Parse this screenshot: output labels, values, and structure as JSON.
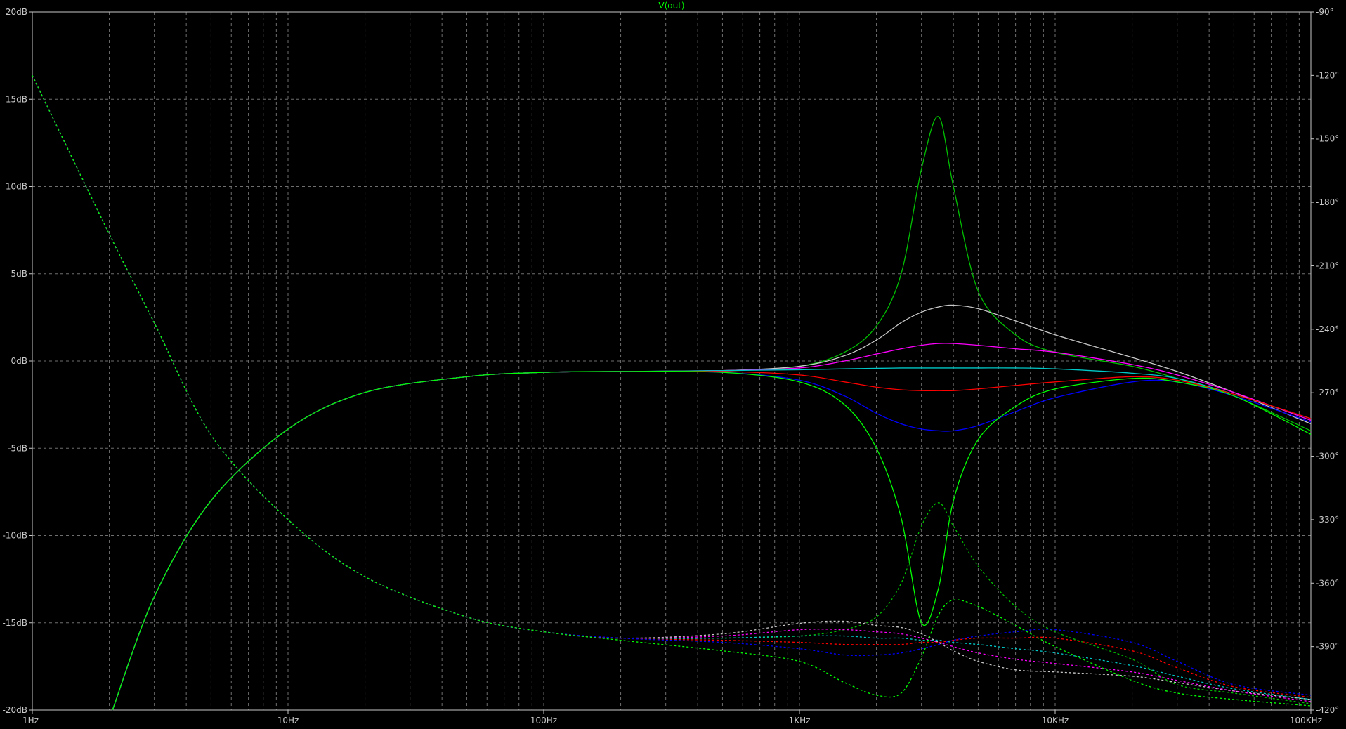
{
  "chart_data": {
    "type": "line",
    "title": "V(out)",
    "x_scale": "log",
    "xlim": [
      1,
      100000
    ],
    "ylim": [
      -20,
      20
    ],
    "y2lim": [
      -420,
      -90
    ],
    "grid": true,
    "x_tick_labels": [
      "1Hz",
      "10Hz",
      "100Hz",
      "1KHz",
      "10KHz",
      "100KHz"
    ],
    "y_tick_labels": [
      "20dB",
      "15dB",
      "10dB",
      "5dB",
      "0dB",
      "-5dB",
      "-10dB",
      "-15dB",
      "-20dB"
    ],
    "y2_tick_labels": [
      "-90°",
      "-120°",
      "-150°",
      "-180°",
      "-210°",
      "-240°",
      "-270°",
      "-300°",
      "-330°",
      "-360°",
      "-390°",
      "-420°"
    ],
    "x_values": [
      1,
      2,
      3,
      5,
      10,
      20,
      50,
      100,
      200,
      500,
      1000,
      1500,
      2000,
      2500,
      3000,
      3500,
      4000,
      5000,
      7000,
      10000,
      20000,
      30000,
      50000,
      100000
    ],
    "series": [
      {
        "color": "#00c000",
        "style": "solid",
        "values": [
          -38.0,
          -20.5,
          -13.5,
          -8.0,
          -3.9,
          -1.8,
          -0.9,
          -0.65,
          -0.6,
          -0.55,
          -0.3,
          0.5,
          2.0,
          5.0,
          11.0,
          14.0,
          10.0,
          4.0,
          1.5,
          0.5,
          -0.3,
          -1.0,
          -2.0,
          -4.0
        ]
      },
      {
        "color": "#c8c8c8",
        "style": "solid",
        "values": [
          -38.0,
          -20.5,
          -13.5,
          -8.0,
          -3.9,
          -1.8,
          -0.9,
          -0.65,
          -0.6,
          -0.55,
          -0.3,
          0.3,
          1.2,
          2.2,
          2.8,
          3.1,
          3.2,
          3.0,
          2.3,
          1.5,
          0.2,
          -0.6,
          -1.8,
          -3.6
        ]
      },
      {
        "color": "#ff00ff",
        "style": "solid",
        "values": [
          -38.0,
          -20.5,
          -13.5,
          -8.0,
          -3.9,
          -1.8,
          -0.9,
          -0.65,
          -0.6,
          -0.55,
          -0.4,
          0.0,
          0.4,
          0.7,
          0.9,
          1.0,
          1.0,
          0.9,
          0.7,
          0.5,
          -0.2,
          -0.8,
          -1.8,
          -3.4
        ]
      },
      {
        "color": "#00c8c8",
        "style": "solid",
        "values": [
          -38.0,
          -20.5,
          -13.5,
          -8.0,
          -3.9,
          -1.8,
          -0.9,
          -0.65,
          -0.6,
          -0.55,
          -0.5,
          -0.45,
          -0.42,
          -0.4,
          -0.4,
          -0.4,
          -0.4,
          -0.4,
          -0.4,
          -0.45,
          -0.7,
          -1.0,
          -1.9,
          -3.3
        ]
      },
      {
        "color": "#ff0000",
        "style": "solid",
        "values": [
          -38.0,
          -20.5,
          -13.5,
          -8.0,
          -3.9,
          -1.8,
          -0.9,
          -0.65,
          -0.6,
          -0.6,
          -0.8,
          -1.2,
          -1.5,
          -1.65,
          -1.7,
          -1.7,
          -1.7,
          -1.6,
          -1.4,
          -1.2,
          -0.9,
          -1.1,
          -1.9,
          -3.3
        ]
      },
      {
        "color": "#0000ff",
        "style": "solid",
        "values": [
          -38.0,
          -20.5,
          -13.5,
          -8.0,
          -3.9,
          -1.8,
          -0.9,
          -0.65,
          -0.6,
          -0.65,
          -1.1,
          -2.0,
          -3.0,
          -3.6,
          -3.9,
          -4.0,
          -4.0,
          -3.7,
          -2.9,
          -2.1,
          -1.2,
          -1.2,
          -2.0,
          -3.5
        ]
      },
      {
        "color": "#00ff00",
        "style": "solid",
        "values": [
          -38.0,
          -20.5,
          -13.5,
          -8.0,
          -3.9,
          -1.8,
          -0.9,
          -0.65,
          -0.6,
          -0.65,
          -1.2,
          -2.5,
          -5.0,
          -9.0,
          -15.0,
          -13.0,
          -8.0,
          -4.5,
          -2.6,
          -1.6,
          -1.0,
          -1.2,
          -2.0,
          -4.2
        ]
      },
      {
        "color": "#00c000",
        "style": "dashed",
        "axis": "phase",
        "values": [
          -120,
          -195,
          -237,
          -290,
          -330,
          -357,
          -376,
          -383,
          -386,
          -386,
          -385,
          -382,
          -376,
          -360,
          -333,
          -322,
          -333,
          -352,
          -371,
          -383,
          -396,
          -408,
          -412,
          -417
        ]
      },
      {
        "color": "#c8c8c8",
        "style": "dashed",
        "axis": "phase",
        "values": [
          -120,
          -195,
          -237,
          -290,
          -330,
          -357,
          -376,
          -383,
          -386,
          -384,
          -379,
          -378,
          -380,
          -381,
          -384,
          -388,
          -392,
          -397,
          -401,
          -402,
          -404,
          -407,
          -411,
          -415
        ]
      },
      {
        "color": "#ff00ff",
        "style": "dashed",
        "axis": "phase",
        "values": [
          -120,
          -195,
          -237,
          -290,
          -330,
          -357,
          -376,
          -383,
          -386,
          -385,
          -382,
          -382,
          -383,
          -384,
          -386,
          -388,
          -390,
          -393,
          -396,
          -398,
          -402,
          -406,
          -411,
          -416
        ]
      },
      {
        "color": "#00c8c8",
        "style": "dashed",
        "axis": "phase",
        "values": [
          -120,
          -195,
          -237,
          -290,
          -330,
          -357,
          -376,
          -383,
          -386,
          -386,
          -385,
          -385,
          -386,
          -386,
          -387,
          -387,
          -388,
          -389,
          -391,
          -393,
          -399,
          -404,
          -410,
          -415
        ]
      },
      {
        "color": "#ff0000",
        "style": "dashed",
        "axis": "phase",
        "values": [
          -120,
          -195,
          -237,
          -290,
          -330,
          -357,
          -376,
          -383,
          -386,
          -387,
          -388,
          -389,
          -389,
          -389,
          -388,
          -388,
          -387,
          -386,
          -386,
          -386,
          -392,
          -400,
          -409,
          -414
        ]
      },
      {
        "color": "#0000ff",
        "style": "dashed",
        "axis": "phase",
        "values": [
          -120,
          -195,
          -237,
          -290,
          -330,
          -357,
          -376,
          -383,
          -386,
          -388,
          -391,
          -394,
          -394,
          -393,
          -391,
          -389,
          -387,
          -385,
          -383,
          -382,
          -388,
          -397,
          -408,
          -413
        ]
      },
      {
        "color": "#00ff00",
        "style": "dashed",
        "axis": "phase",
        "values": [
          -120,
          -195,
          -237,
          -290,
          -330,
          -357,
          -376,
          -383,
          -387,
          -392,
          -397,
          -407,
          -413,
          -412,
          -395,
          -375,
          -368,
          -371,
          -380,
          -390,
          -406,
          -412,
          -415,
          -418
        ]
      }
    ]
  }
}
